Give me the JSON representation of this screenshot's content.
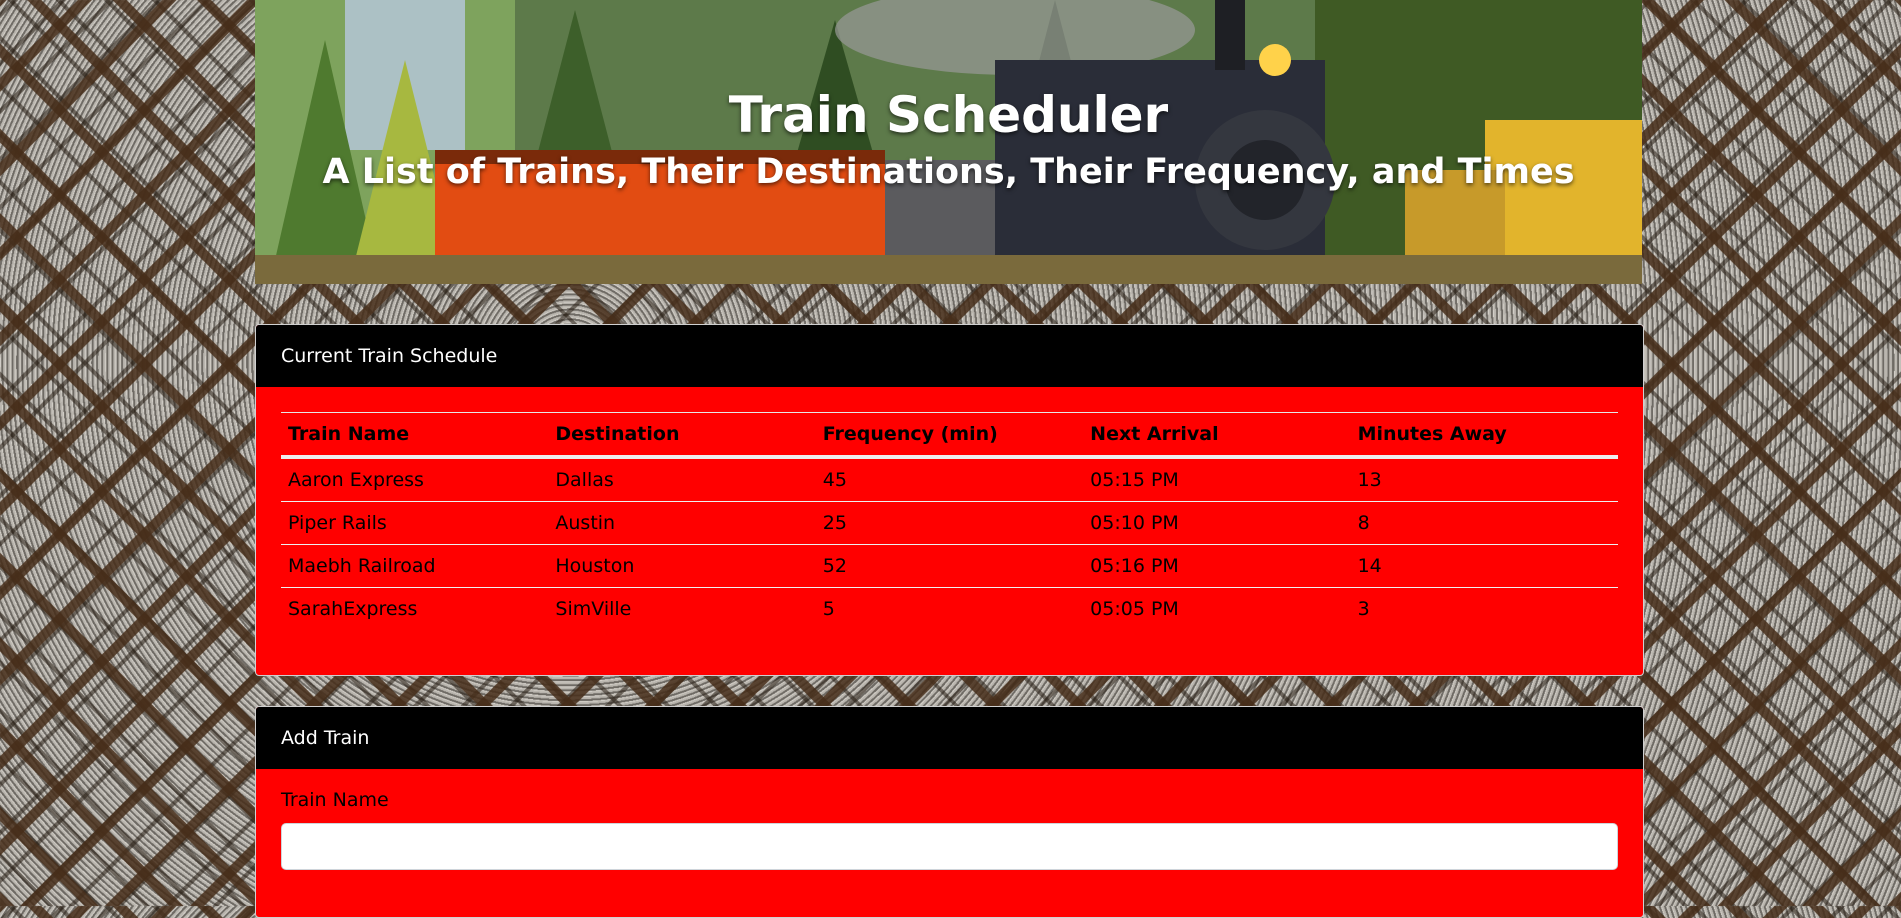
{
  "header": {
    "title": "Train Scheduler",
    "subtitle": "A List of Trains, Their Destinations, Their Frequency, and Times"
  },
  "schedule": {
    "heading": "Current Train Schedule",
    "columns": [
      "Train Name",
      "Destination",
      "Frequency (min)",
      "Next Arrival",
      "Minutes Away"
    ],
    "rows": [
      [
        "Aaron Express",
        "Dallas",
        "45",
        "05:15 PM",
        "13"
      ],
      [
        "Piper Rails",
        "Austin",
        "25",
        "05:10 PM",
        "8"
      ],
      [
        "Maebh Railroad",
        "Houston",
        "52",
        "05:16 PM",
        "14"
      ],
      [
        "SarahExpress",
        "SimVille",
        "5",
        "05:05 PM",
        "3"
      ]
    ]
  },
  "add_train": {
    "heading": "Add Train",
    "train_name_label": "Train Name",
    "train_name_value": ""
  },
  "colors": {
    "card_body": "#ff0000",
    "card_header": "#000000",
    "header_text": "#ffffff"
  }
}
